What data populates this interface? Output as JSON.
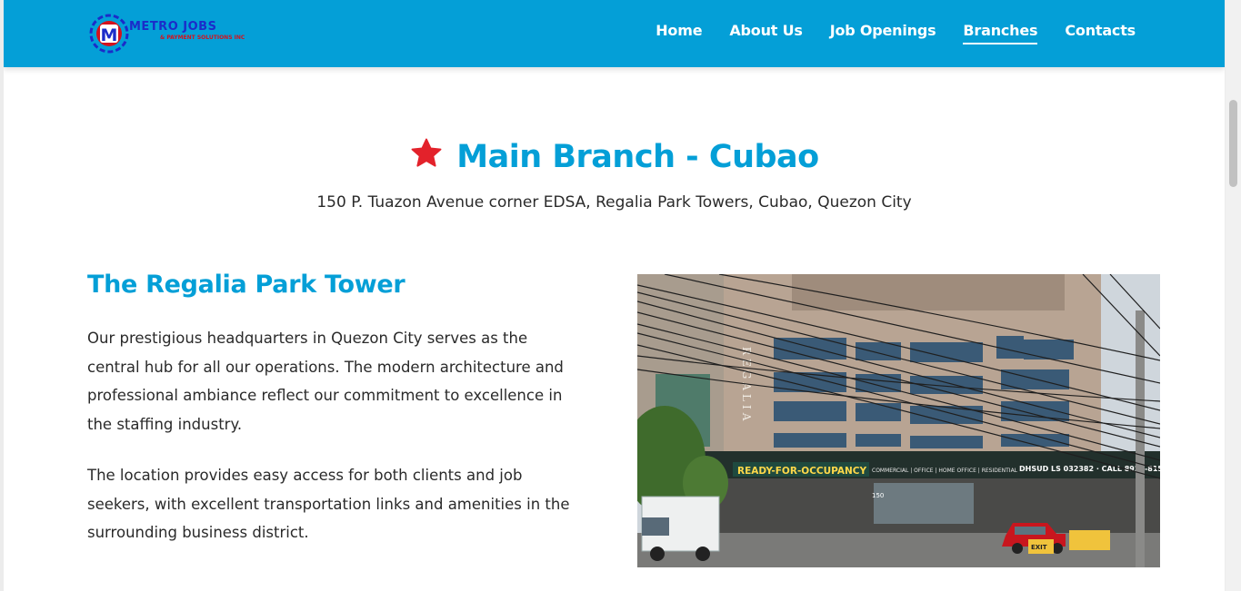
{
  "header": {
    "logo": {
      "main_text": "METRO JOBS",
      "sub_text": "& PAYMENT SOLUTIONS INC",
      "badge_letter": "M"
    },
    "nav": [
      {
        "label": "Home",
        "active": false
      },
      {
        "label": "About Us",
        "active": false
      },
      {
        "label": "Job Openings",
        "active": false
      },
      {
        "label": "Branches",
        "active": true
      },
      {
        "label": "Contacts",
        "active": false
      }
    ]
  },
  "branch": {
    "title": "Main Branch - Cubao",
    "icon": "star-icon",
    "address": "150 P. Tuazon Avenue corner EDSA, Regalia Park Towers, Cubao, Quezon City"
  },
  "section": {
    "title": "The Regalia Park Tower",
    "paragraph1": "Our prestigious headquarters in Quezon City serves as the central hub for all our operations. The modern architecture and professional ambiance reflect our commitment to excellence in the staffing industry.",
    "paragraph2": "The location provides easy access for both clients and job seekers, with excellent transportation links and amenities in the surrounding business district."
  },
  "photo": {
    "signage": {
      "vertical_sign": "REGALIA",
      "banner": "READY-FOR-OCCUPANCY",
      "uses": "COMMERCIAL | OFFICE | HOME OFFICE | RESIDENTIAL",
      "license": "DHSUD LS 032382 · CALL 8921-8151",
      "exit": "EXIT",
      "number": "150"
    }
  },
  "colors": {
    "brand_blue": "#049fd7",
    "accent_red": "#e3222b",
    "text": "#2a2a2a"
  }
}
